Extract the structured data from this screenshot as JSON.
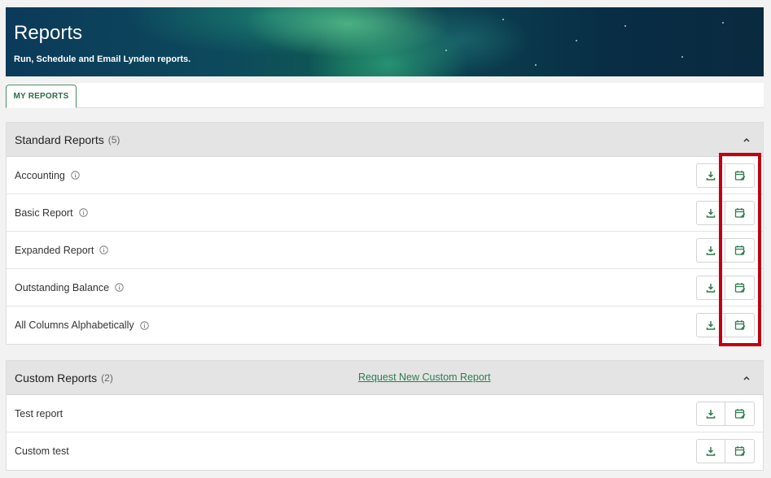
{
  "header": {
    "title": "Reports",
    "subtitle": "Run, Schedule and Email Lynden reports."
  },
  "tabs": [
    {
      "label": "MY REPORTS",
      "active": true
    }
  ],
  "standard": {
    "title": "Standard Reports",
    "count": "(5)",
    "collapse_icon": "chevron-up-icon",
    "items": [
      {
        "label": "Accounting",
        "info_icon": "info-icon"
      },
      {
        "label": "Basic Report",
        "info_icon": "info-icon"
      },
      {
        "label": "Expanded Report",
        "info_icon": "info-icon"
      },
      {
        "label": "Outstanding Balance",
        "info_icon": "info-icon"
      },
      {
        "label": "All Columns Alphabetically",
        "info_icon": "info-icon"
      }
    ]
  },
  "custom": {
    "title": "Custom Reports",
    "count": "(2)",
    "request_link": "Request New Custom Report",
    "collapse_icon": "chevron-up-icon",
    "items": [
      {
        "label": "Test report"
      },
      {
        "label": "Custom test"
      }
    ]
  },
  "row_actions": {
    "download_icon": "download-icon",
    "schedule_icon": "calendar-edit-icon"
  },
  "colors": {
    "accent_green": "#2e7d4f",
    "highlight_red": "#c00010",
    "panel_header_bg": "#e4e4e4"
  }
}
